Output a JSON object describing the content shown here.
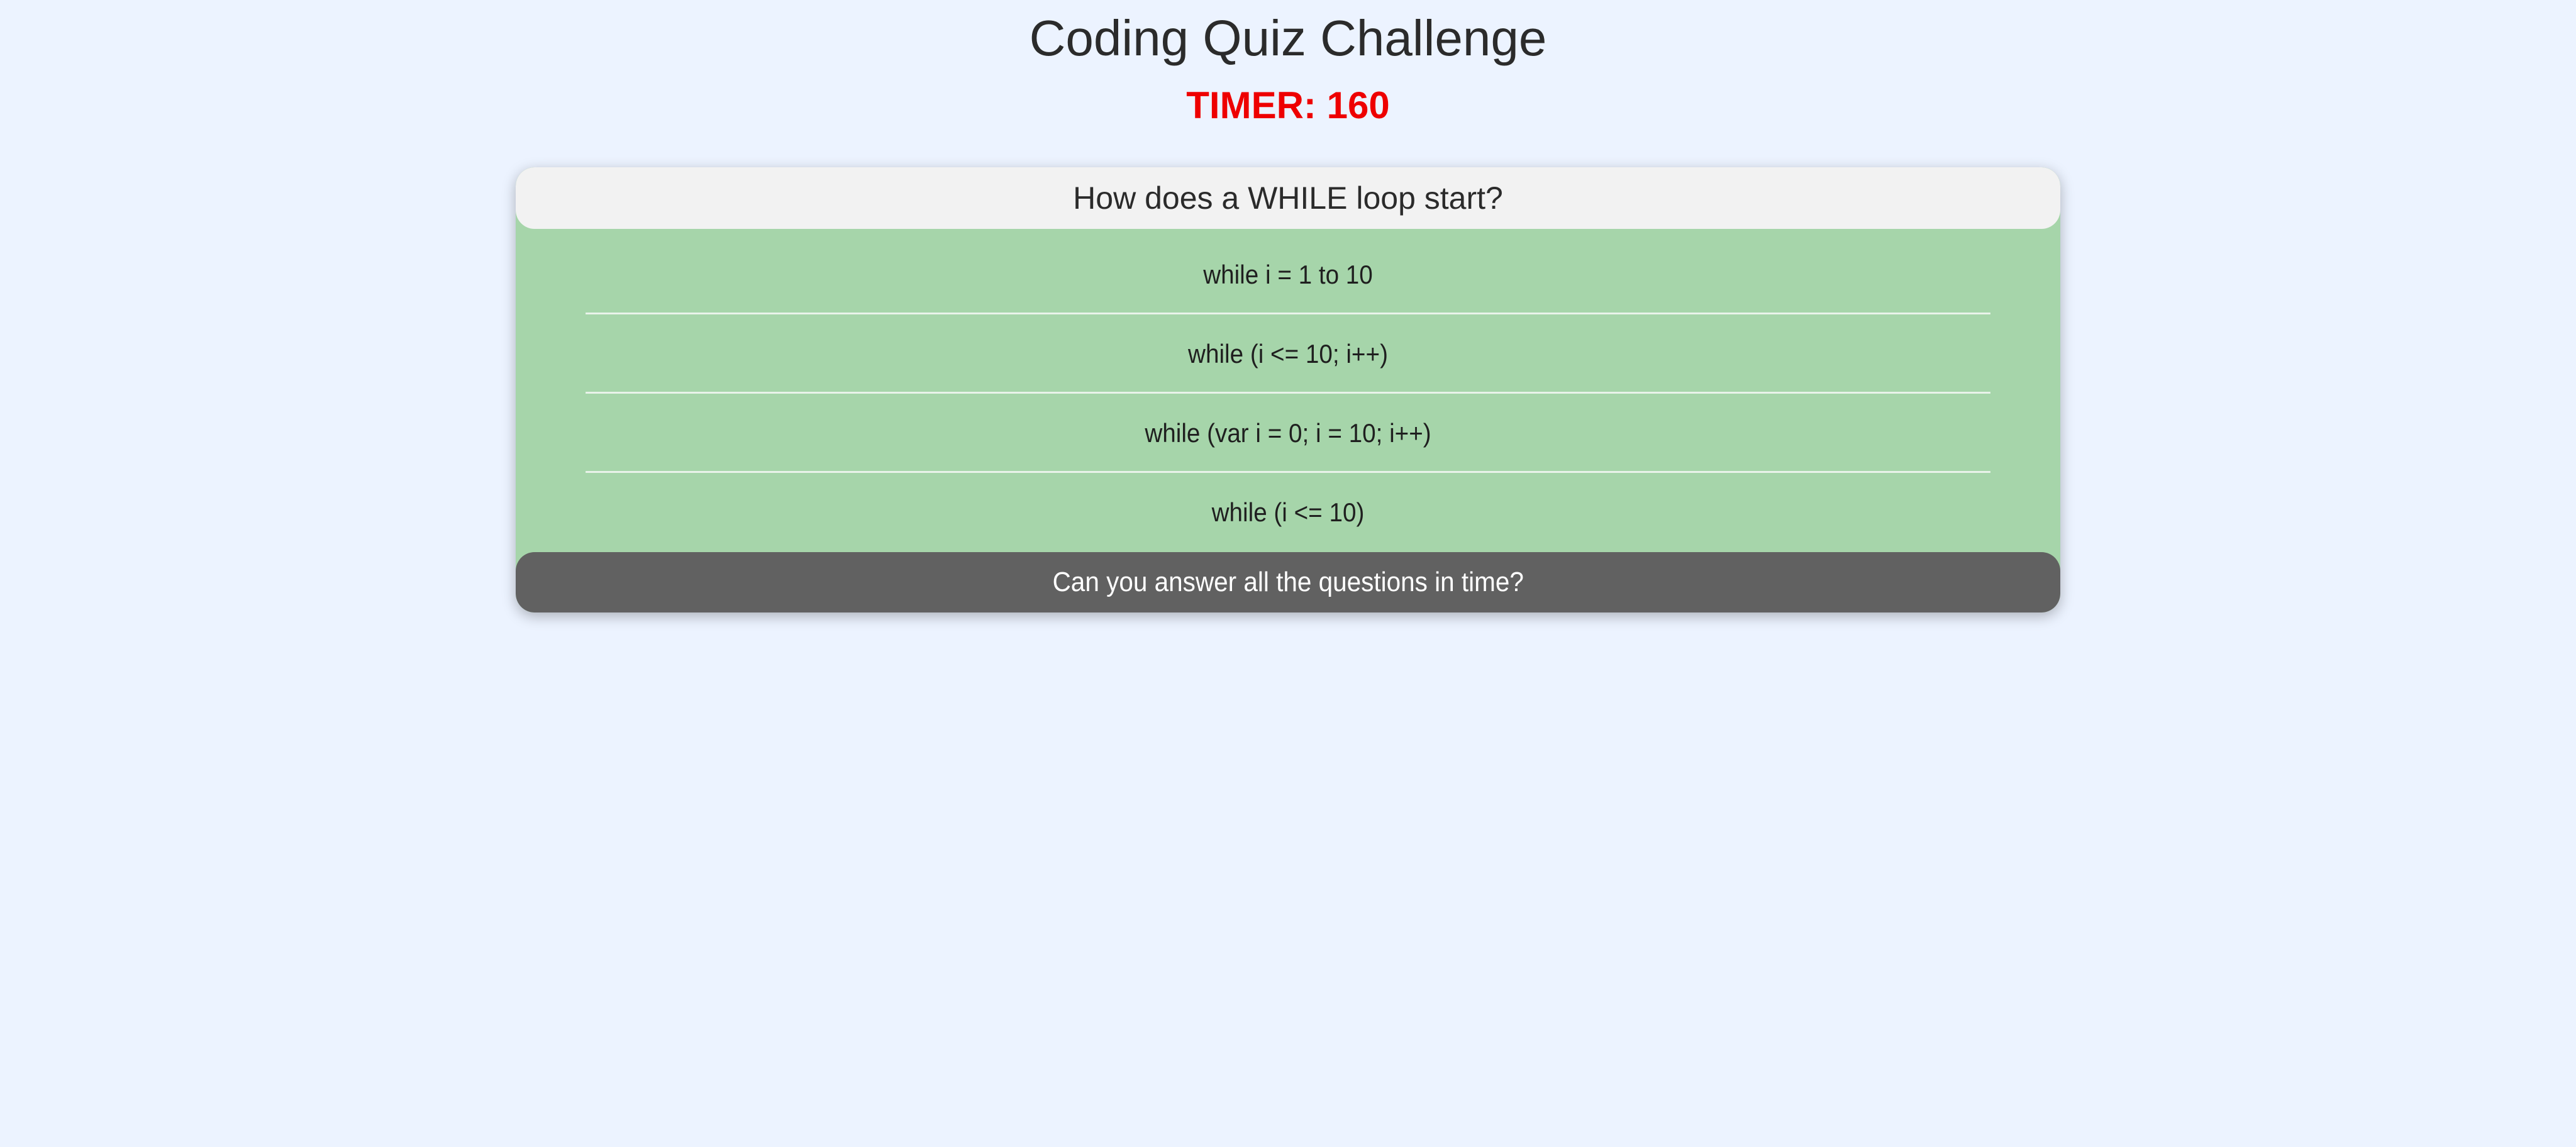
{
  "header": {
    "title": "Coding Quiz Challenge",
    "timer_label": "TIMER: 160"
  },
  "quiz": {
    "question": "How does a WHILE loop start?",
    "answers": [
      {
        "label": "while i = 1 to 10"
      },
      {
        "label": "while (i <= 10; i++)"
      },
      {
        "label": "while (var i = 0; i = 10; i++)"
      },
      {
        "label": "while (i <= 10)"
      }
    ],
    "footer_message": "Can you answer all the questions in time?"
  },
  "colors": {
    "background": "#ecf3ff",
    "timer": "#ee0000",
    "answer_background": "#a6d5aa",
    "question_background": "#f2f2f2",
    "footer_background": "#616161"
  }
}
